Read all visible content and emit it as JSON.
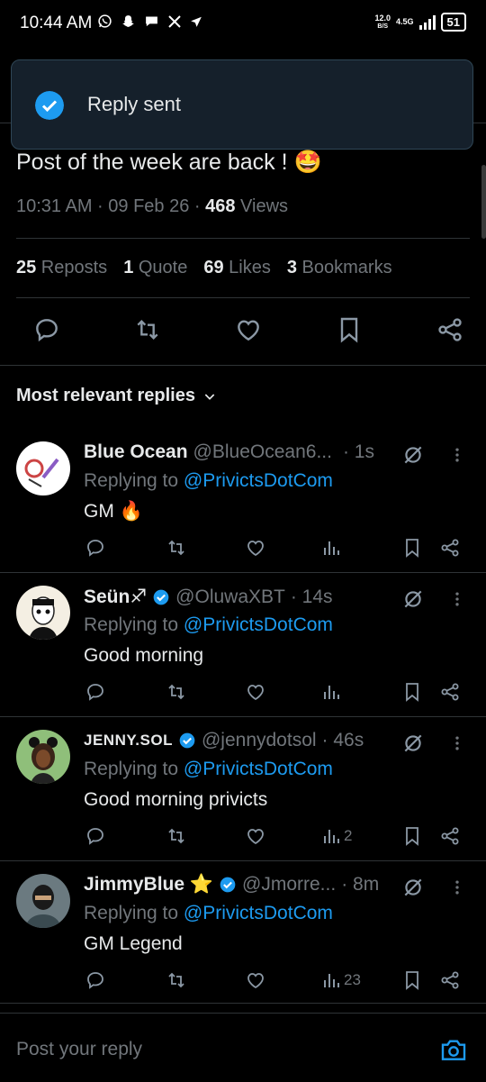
{
  "status_bar": {
    "time": "10:44 AM",
    "notification_icons": [
      "whatsapp-icon",
      "snapchat-icon",
      "chat-icon",
      "x-icon",
      "send-icon"
    ],
    "net_speed": "12.0",
    "net_unit": "B/S",
    "network_type": "4.5G",
    "battery": "51"
  },
  "toast": {
    "message": "Reply sent"
  },
  "post": {
    "text": "Post of the week are back ! 🤩",
    "time": "10:31 AM · 09 Feb 26 · ",
    "views_count": "468",
    "views_label": " Views",
    "stats": [
      {
        "count": "25",
        "label": " Reposts"
      },
      {
        "count": "1",
        "label": " Quote"
      },
      {
        "count": "69",
        "label": " Likes"
      },
      {
        "count": "3",
        "label": " Bookmarks"
      }
    ]
  },
  "replies_filter": {
    "label": "Most relevant replies"
  },
  "replies": [
    {
      "name": "Blue Ocean",
      "handle": "@BlueOcean6...",
      "time": "· 1s",
      "replying_prefix": "Replying to ",
      "replying_to": "@PrivictsDotCom",
      "text": "GM 🔥",
      "views": ""
    },
    {
      "name": "Seün♐",
      "handle": "@OluwaXBT",
      "time": "· 14s",
      "replying_prefix": "Replying to ",
      "replying_to": "@PrivictsDotCom",
      "text": "Good morning",
      "views": ""
    },
    {
      "name": "JENNY.SOL",
      "handle": "@jennydotsol",
      "time": "· 46s",
      "replying_prefix": "Replying to ",
      "replying_to": "@PrivictsDotCom",
      "text": "Good morning privicts",
      "views": "2"
    },
    {
      "name": "JimmyBlue ⭐",
      "handle": "@Jmorre...",
      "time": "· 8m",
      "replying_prefix": "Replying to ",
      "replying_to": "@PrivictsDotCom",
      "text": "GM Legend",
      "views": "23"
    }
  ],
  "composer": {
    "placeholder": "Post your reply"
  },
  "colors": {
    "accent": "#1d9bf0",
    "background": "#000000",
    "muted": "#71767b",
    "text": "#e7e9ea"
  }
}
